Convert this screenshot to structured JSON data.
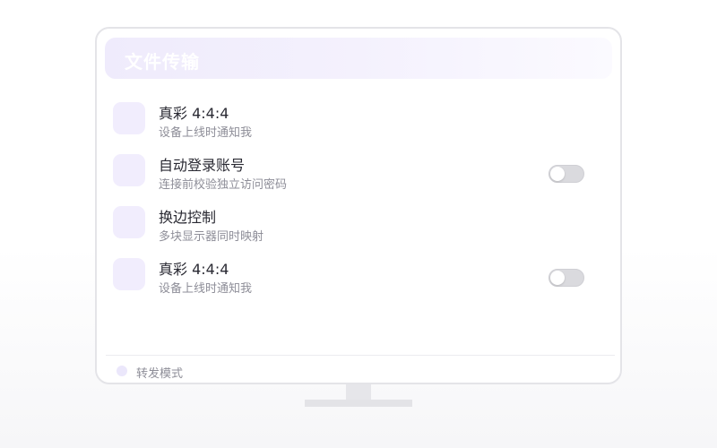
{
  "header": {
    "title": "文件传输"
  },
  "rows": [
    {
      "title": "真彩 4:4:4",
      "subtitle": "设备上线时通知我",
      "has_toggle": false
    },
    {
      "title": "自动登录账号",
      "subtitle": "连接前校验独立访问密码",
      "has_toggle": true,
      "toggle_on": false
    },
    {
      "title": "换边控制",
      "subtitle": "多块显示器同时映射",
      "has_toggle": false
    },
    {
      "title": "真彩 4:4:4",
      "subtitle": "设备上线时通知我",
      "has_toggle": true,
      "toggle_on": false
    }
  ],
  "footer": {
    "label": "转发模式"
  },
  "colors": {
    "accent_light": "#f1edfd",
    "toggle_off": "#dadade",
    "text_primary": "#2a2a33",
    "text_secondary": "#8e8e98"
  },
  "icons": {
    "footer_indicator": "dot-icon"
  }
}
